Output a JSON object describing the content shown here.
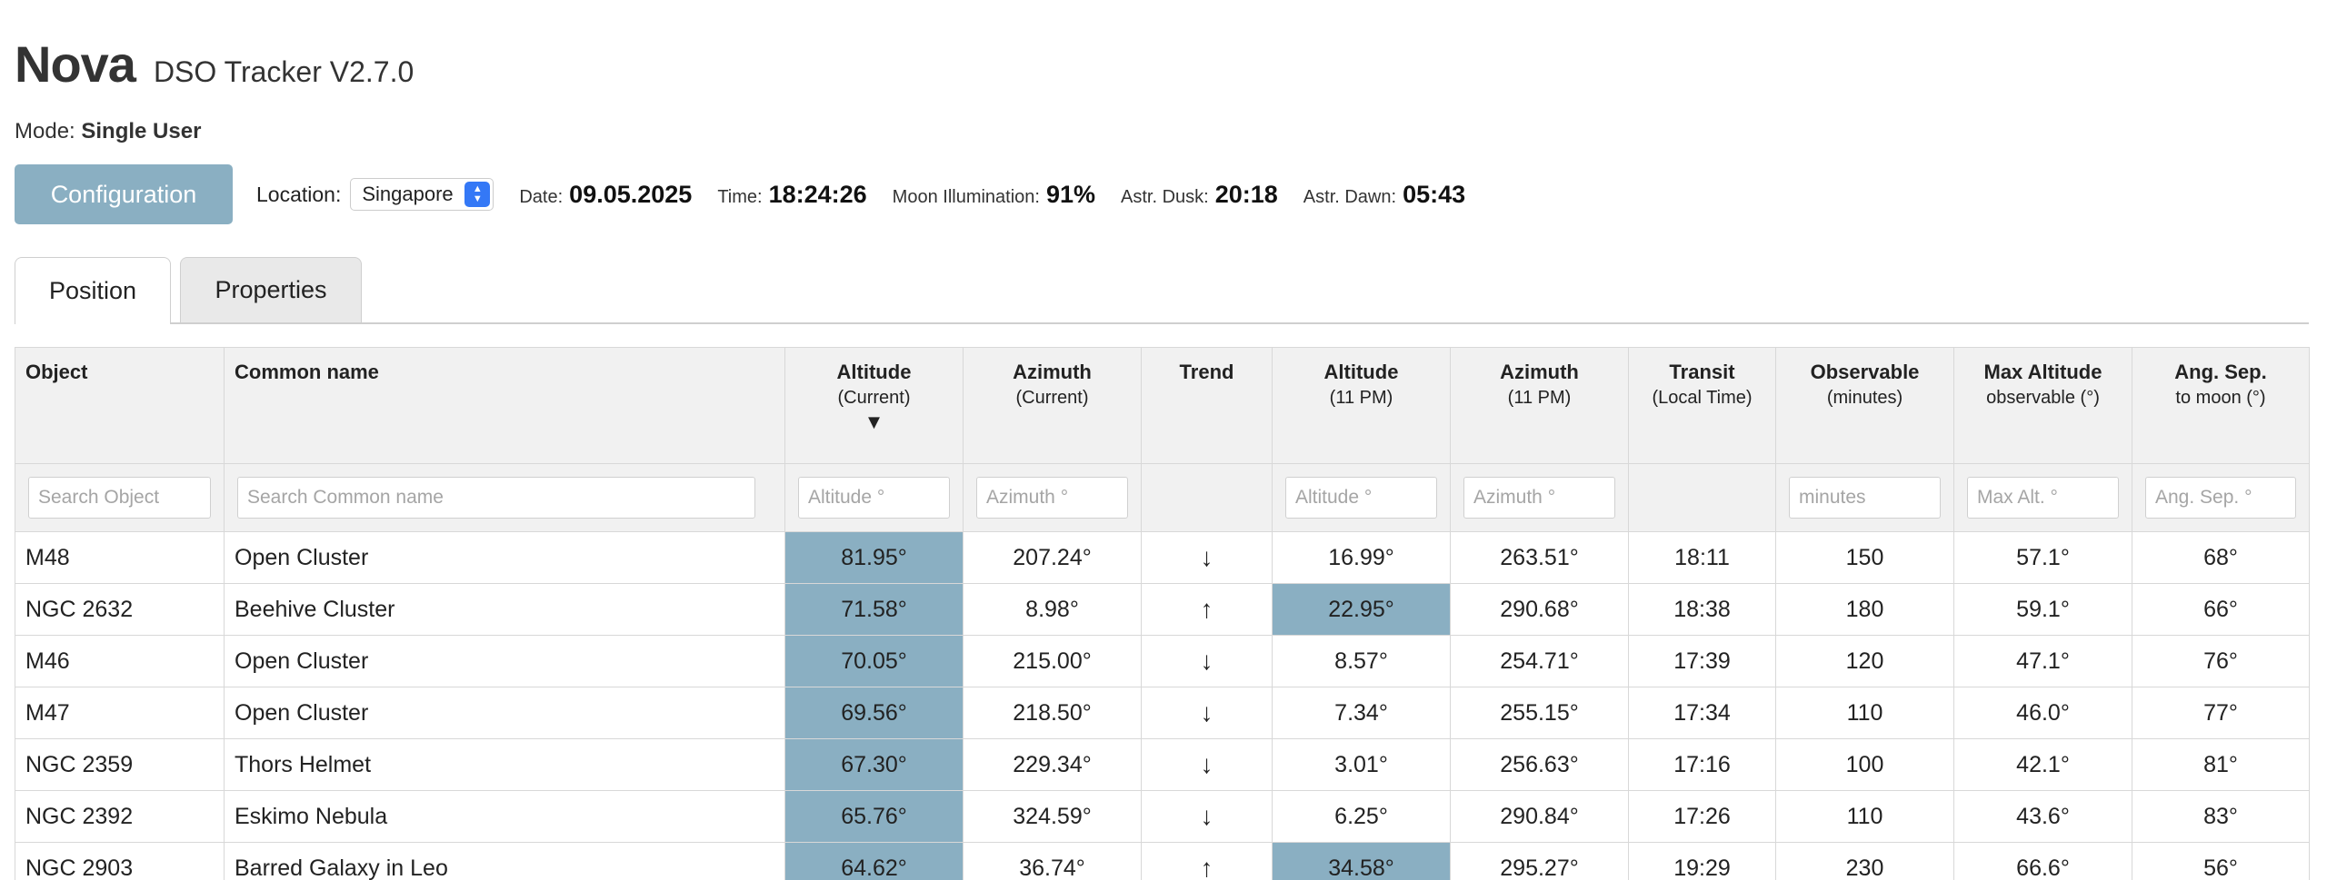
{
  "app": {
    "name": "Nova",
    "subtitle": "DSO Tracker V2.7.0"
  },
  "mode": {
    "label": "Mode:",
    "value": "Single User"
  },
  "toolbar": {
    "config_label": "Configuration",
    "location_label": "Location:",
    "location_value": "Singapore",
    "date_label": "Date:",
    "date_value": "09.05.2025",
    "time_label": "Time:",
    "time_value": "18:24:26",
    "moon_label": "Moon Illumination:",
    "moon_value": "91%",
    "dusk_label": "Astr. Dusk:",
    "dusk_value": "20:18",
    "dawn_label": "Astr. Dawn:",
    "dawn_value": "05:43"
  },
  "tabs": [
    {
      "label": "Position",
      "active": true
    },
    {
      "label": "Properties",
      "active": false
    }
  ],
  "table": {
    "headers": [
      {
        "title": "Object",
        "sub": ""
      },
      {
        "title": "Common name",
        "sub": ""
      },
      {
        "title": "Altitude",
        "sub": "(Current)",
        "sort": "▼"
      },
      {
        "title": "Azimuth",
        "sub": "(Current)"
      },
      {
        "title": "Trend",
        "sub": ""
      },
      {
        "title": "Altitude",
        "sub": "(11 PM)"
      },
      {
        "title": "Azimuth",
        "sub": "(11 PM)"
      },
      {
        "title": "Transit",
        "sub": "(Local Time)"
      },
      {
        "title": "Observable",
        "sub": "(minutes)"
      },
      {
        "title": "Max Altitude",
        "sub": "observable (°)"
      },
      {
        "title": "Ang. Sep.",
        "sub": "to moon (°)"
      }
    ],
    "filters": {
      "object": "Search Object",
      "common": "Search Common name",
      "alt_current": "Altitude °",
      "az_current": "Azimuth °",
      "alt_11pm": "Altitude °",
      "az_11pm": "Azimuth °",
      "observable": "minutes",
      "max_alt": "Max Alt. °",
      "ang_sep": "Ang. Sep. °"
    },
    "rows": [
      {
        "object": "M48",
        "common": "Open Cluster",
        "alt": "81.95°",
        "az": "207.24°",
        "trend": "↓",
        "alt11": "16.99°",
        "az11": "263.51°",
        "transit": "18:11",
        "observable": "150",
        "maxalt": "57.1°",
        "angsep": "68°",
        "hl_alt": true,
        "hl_alt11": false
      },
      {
        "object": "NGC 2632",
        "common": "Beehive Cluster",
        "alt": "71.58°",
        "az": "8.98°",
        "trend": "↑",
        "alt11": "22.95°",
        "az11": "290.68°",
        "transit": "18:38",
        "observable": "180",
        "maxalt": "59.1°",
        "angsep": "66°",
        "hl_alt": true,
        "hl_alt11": true
      },
      {
        "object": "M46",
        "common": "Open Cluster",
        "alt": "70.05°",
        "az": "215.00°",
        "trend": "↓",
        "alt11": "8.57°",
        "az11": "254.71°",
        "transit": "17:39",
        "observable": "120",
        "maxalt": "47.1°",
        "angsep": "76°",
        "hl_alt": true,
        "hl_alt11": false
      },
      {
        "object": "M47",
        "common": "Open Cluster",
        "alt": "69.56°",
        "az": "218.50°",
        "trend": "↓",
        "alt11": "7.34°",
        "az11": "255.15°",
        "transit": "17:34",
        "observable": "110",
        "maxalt": "46.0°",
        "angsep": "77°",
        "hl_alt": true,
        "hl_alt11": false
      },
      {
        "object": "NGC 2359",
        "common": "Thors Helmet",
        "alt": "67.30°",
        "az": "229.34°",
        "trend": "↓",
        "alt11": "3.01°",
        "az11": "256.63°",
        "transit": "17:16",
        "observable": "100",
        "maxalt": "42.1°",
        "angsep": "81°",
        "hl_alt": true,
        "hl_alt11": false
      },
      {
        "object": "NGC 2392",
        "common": "Eskimo Nebula",
        "alt": "65.76°",
        "az": "324.59°",
        "trend": "↓",
        "alt11": "6.25°",
        "az11": "290.84°",
        "transit": "17:26",
        "observable": "110",
        "maxalt": "43.6°",
        "angsep": "83°",
        "hl_alt": true,
        "hl_alt11": false
      },
      {
        "object": "NGC 2903",
        "common": "Barred Galaxy in Leo",
        "alt": "64.62°",
        "az": "36.74°",
        "trend": "↑",
        "alt11": "34.58°",
        "az11": "295.27°",
        "transit": "19:29",
        "observable": "230",
        "maxalt": "66.6°",
        "angsep": "56°",
        "hl_alt": true,
        "hl_alt11": true
      }
    ]
  },
  "colors": {
    "accent": "#8aafc2",
    "header_bg": "#f1f1f1",
    "select_arrow": "#3478f6"
  }
}
